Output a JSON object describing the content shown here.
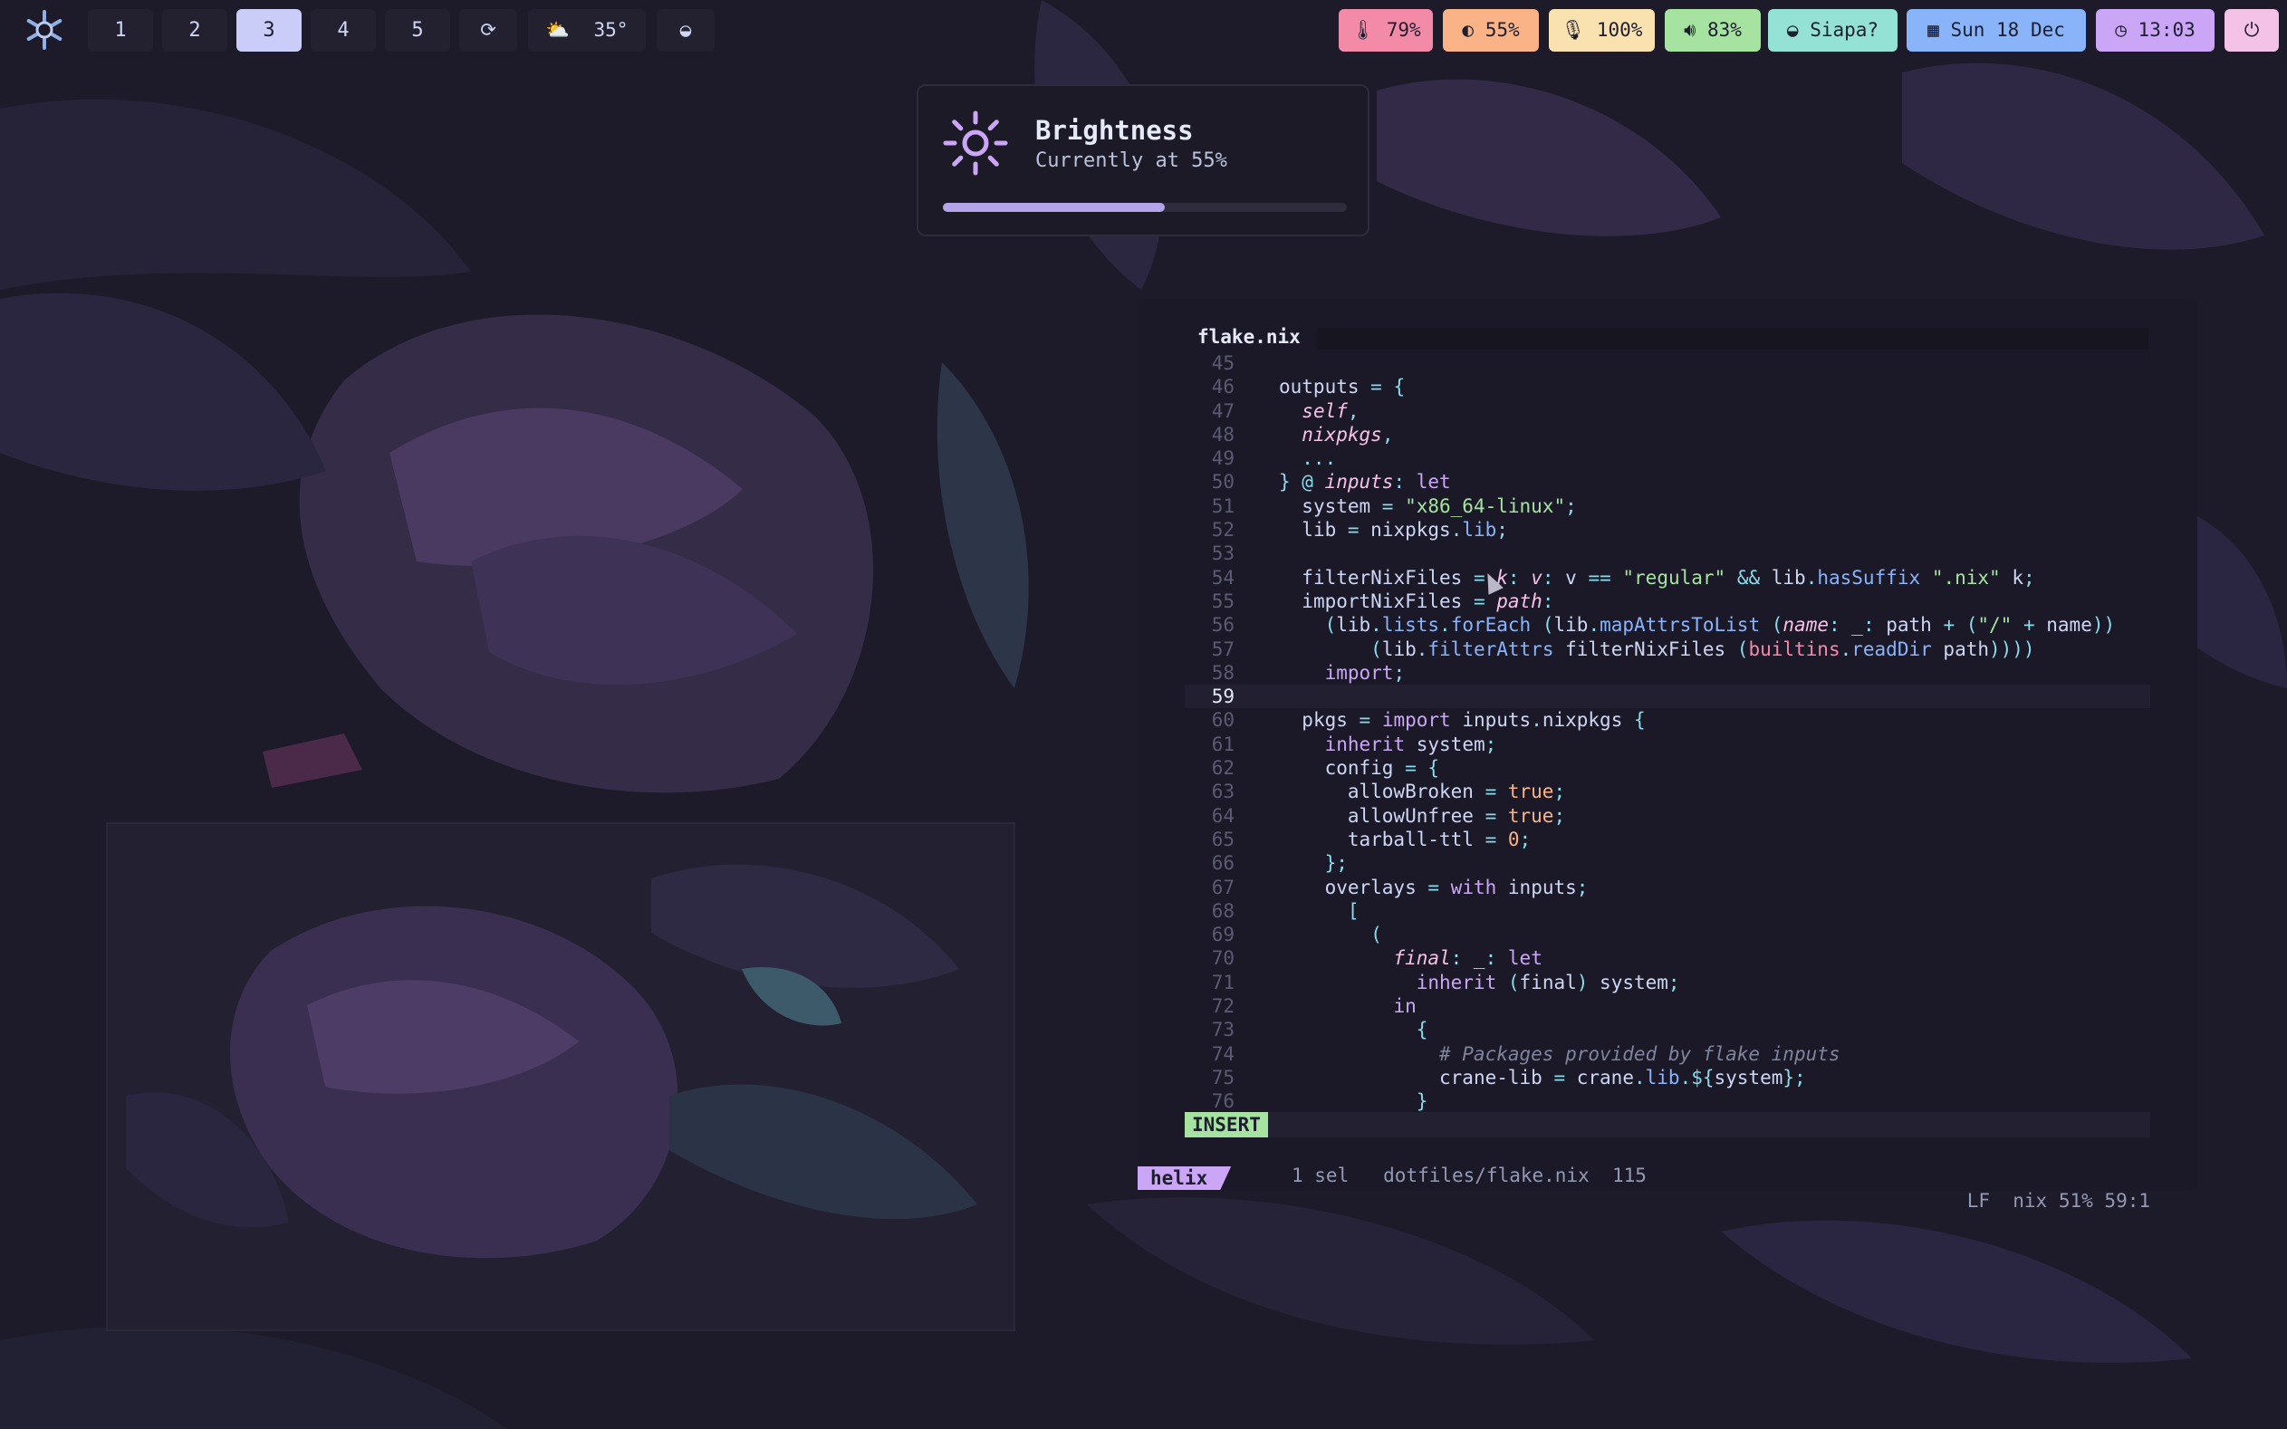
{
  "workspaces": [
    "1",
    "2",
    "3",
    "4",
    "5"
  ],
  "active_workspace": "3",
  "weather": {
    "temp": "35°"
  },
  "stats": [
    {
      "label": "79%",
      "color": "#f38ba8",
      "icon": "thermometer-icon"
    },
    {
      "label": "55%",
      "color": "#fab387",
      "icon": "brightness-icon"
    },
    {
      "label": "100%",
      "color": "#f9e2af",
      "icon": "microphone-icon"
    },
    {
      "label": "83%",
      "color": "#a6e3a1",
      "icon": "volume-icon"
    },
    {
      "label": "Siapa?",
      "color": "#94e2d5",
      "icon": "wifi-icon"
    },
    {
      "label": "Sun 18 Dec",
      "color": "#89b4fa",
      "icon": "calendar-icon"
    },
    {
      "label": "13:03",
      "color": "#cba6f7",
      "icon": "clock-icon"
    }
  ],
  "osd": {
    "title": "Brightness",
    "subtitle": "Currently at 55%",
    "level": 0.55
  },
  "editor": {
    "tab": "flake.nix",
    "lines": [
      {
        "n": "45",
        "t": ""
      },
      {
        "n": "46",
        "t": "outputs = {"
      },
      {
        "n": "47",
        "t": "  self,"
      },
      {
        "n": "48",
        "t": "  nixpkgs,"
      },
      {
        "n": "49",
        "t": "  ..."
      },
      {
        "n": "50",
        "t": "} @ inputs: let"
      },
      {
        "n": "51",
        "t": "  system = \"x86_64-linux\";"
      },
      {
        "n": "52",
        "t": "  lib = nixpkgs.lib;"
      },
      {
        "n": "53",
        "t": ""
      },
      {
        "n": "54",
        "t": "  filterNixFiles = k: v: v == \"regular\" && lib.hasSuffix \".nix\" k;"
      },
      {
        "n": "55",
        "t": "  importNixFiles = path:"
      },
      {
        "n": "56",
        "t": "    (lib.lists.forEach (lib.mapAttrsToList (name: _: path + (\"/\" + name))"
      },
      {
        "n": "57",
        "t": "        (lib.filterAttrs filterNixFiles (builtins.readDir path))))"
      },
      {
        "n": "58",
        "t": "    import;"
      },
      {
        "n": "59",
        "t": ""
      },
      {
        "n": "60",
        "t": "  pkgs = import inputs.nixpkgs {"
      },
      {
        "n": "61",
        "t": "    inherit system;"
      },
      {
        "n": "62",
        "t": "    config = {"
      },
      {
        "n": "63",
        "t": "      allowBroken = true;"
      },
      {
        "n": "64",
        "t": "      allowUnfree = true;"
      },
      {
        "n": "65",
        "t": "      tarball-ttl = 0;"
      },
      {
        "n": "66",
        "t": "    };"
      },
      {
        "n": "67",
        "t": "    overlays = with inputs;"
      },
      {
        "n": "68",
        "t": "      ["
      },
      {
        "n": "69",
        "t": "        ("
      },
      {
        "n": "70",
        "t": "          final: _: let"
      },
      {
        "n": "71",
        "t": "            inherit (final) system;"
      },
      {
        "n": "72",
        "t": "          in"
      },
      {
        "n": "73",
        "t": "            {"
      },
      {
        "n": "74",
        "t": "              # Packages provided by flake inputs"
      },
      {
        "n": "75",
        "t": "              crane-lib = crane.lib.${system};"
      },
      {
        "n": "76",
        "t": "            }"
      }
    ],
    "current_line": "59",
    "status": {
      "mode": "INSERT",
      "left": "1 sel   dotfiles/flake.nix  115",
      "right": "LF  nix 51% 59:1"
    },
    "app_tag": "helix"
  }
}
